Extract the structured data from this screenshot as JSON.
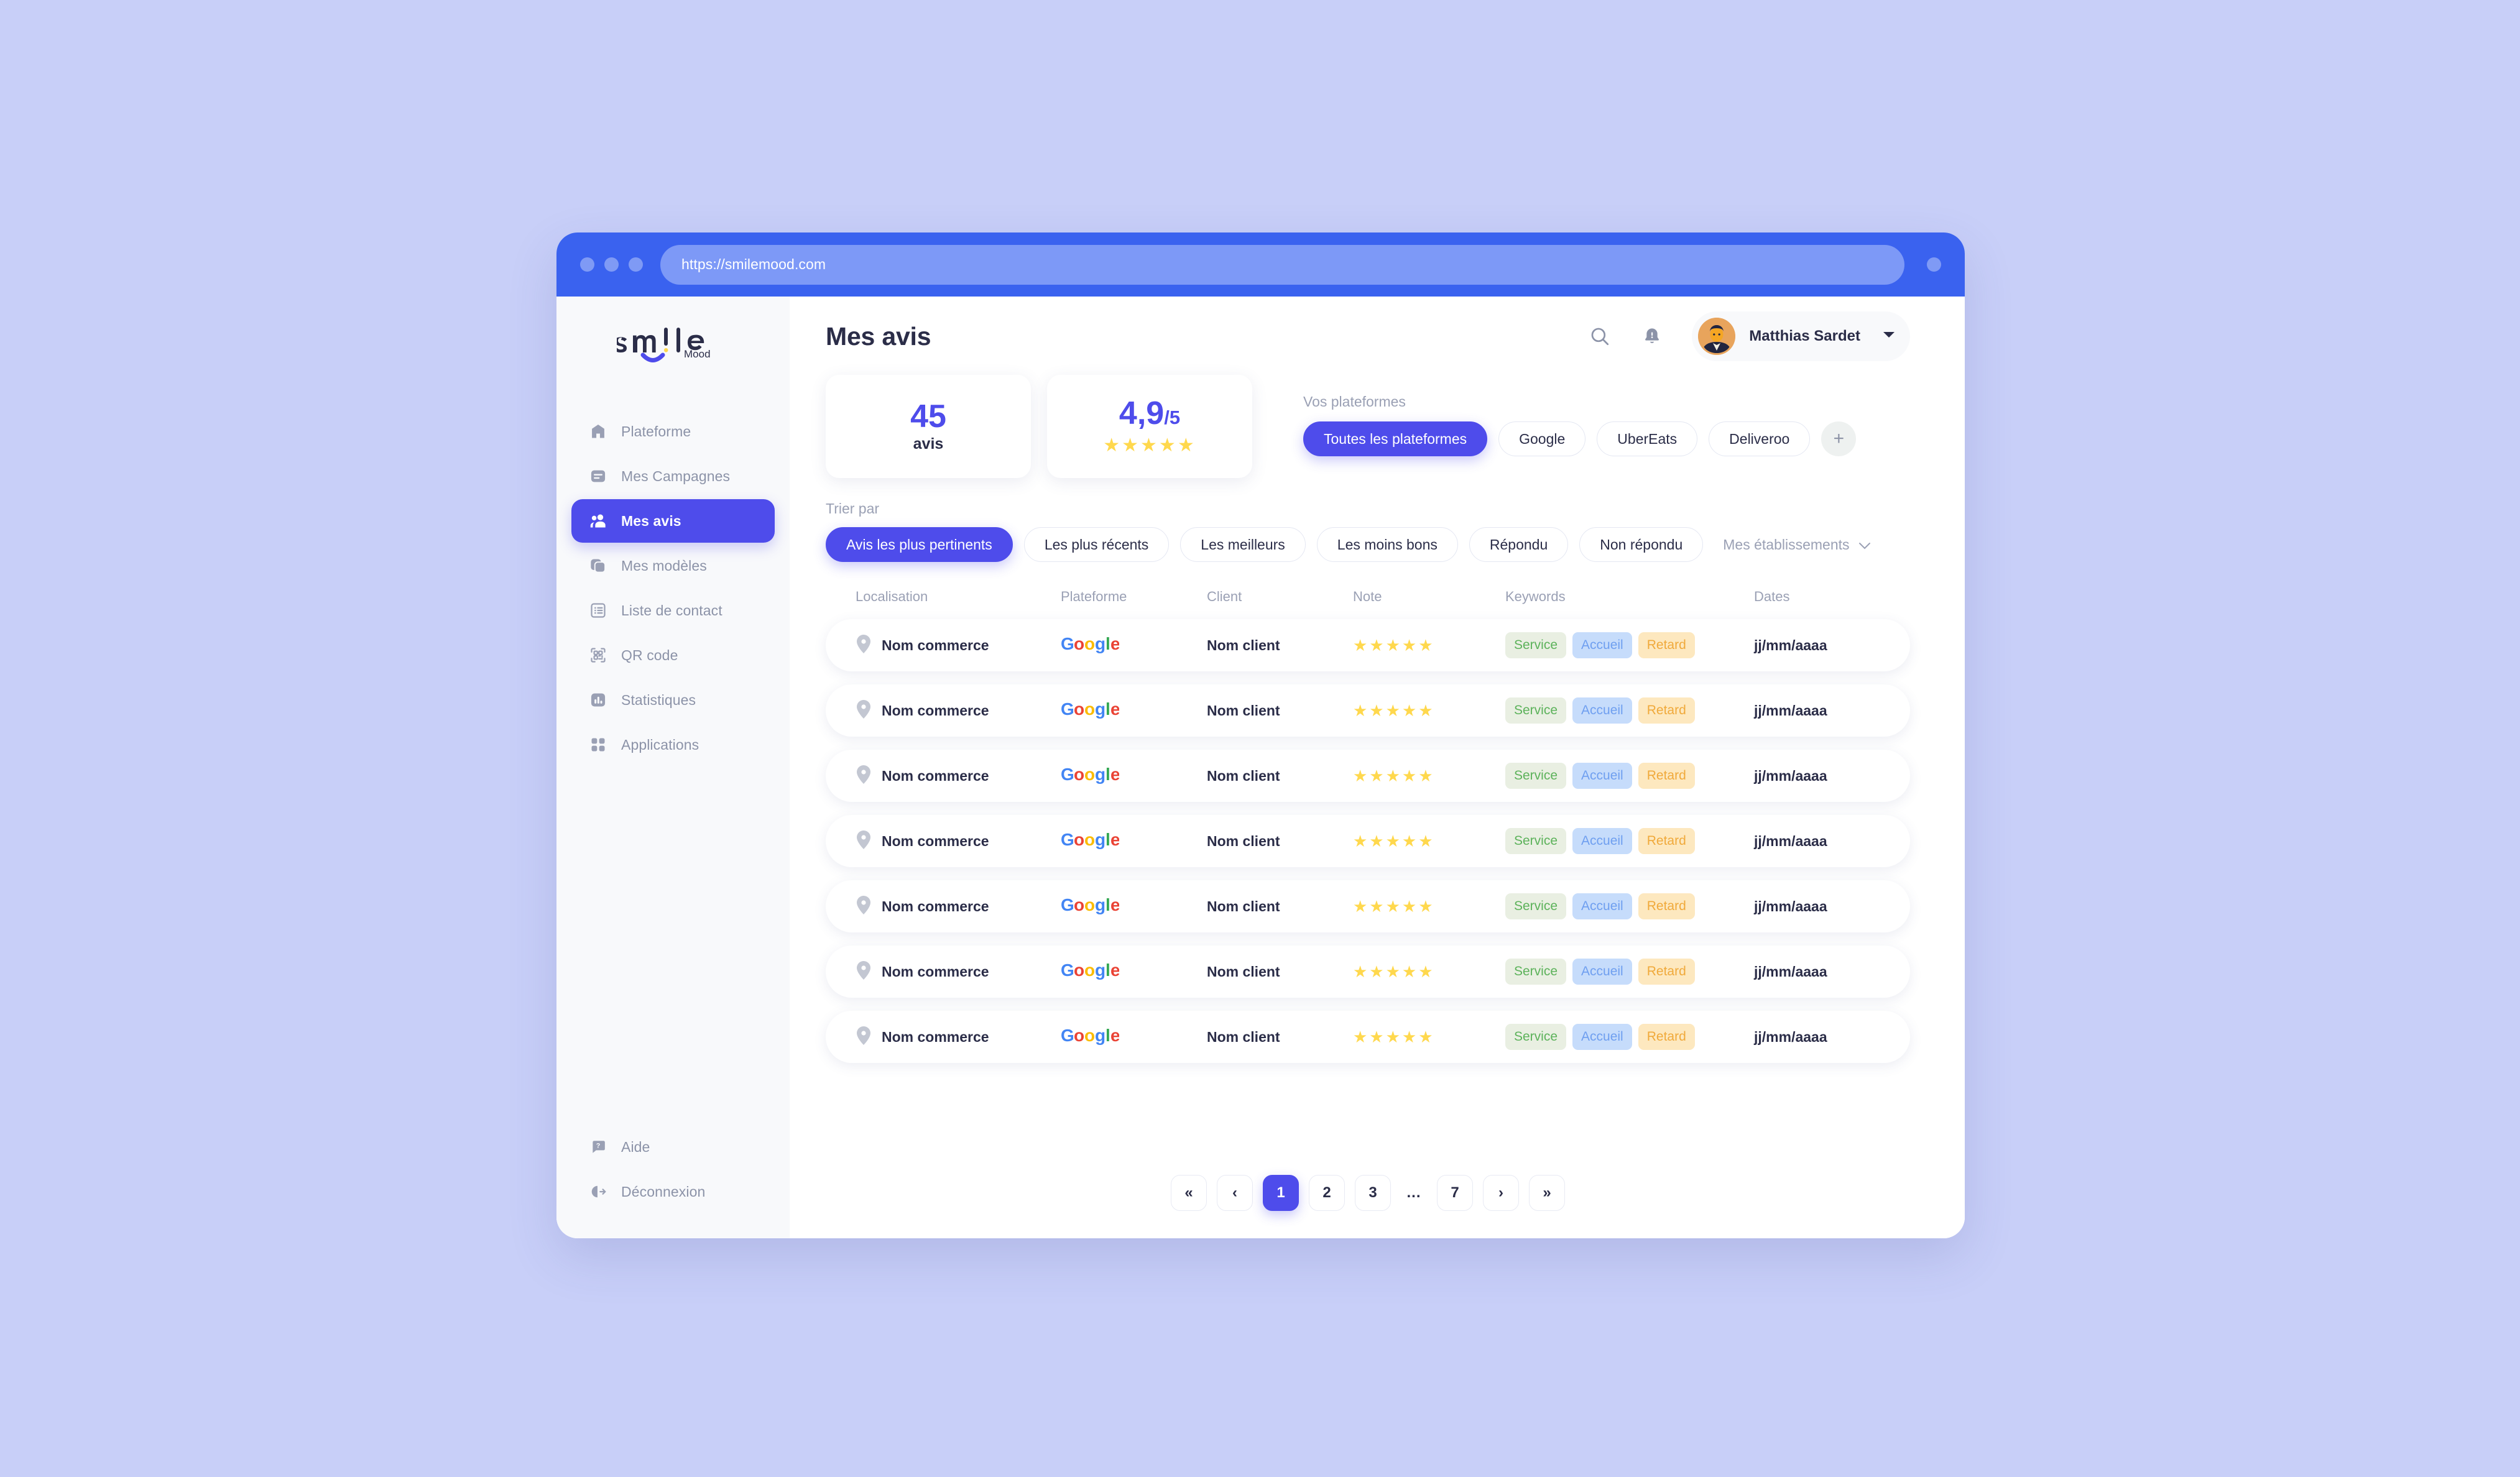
{
  "browser": {
    "url": "https://smilemood.com"
  },
  "brand": {
    "logo_word": "smile",
    "logo_sub": "Mood",
    "accent": "#4e4ceb",
    "chrome_blue": "#3a62ef",
    "star_yellow": "#ffd84d",
    "page_bg": "#c8cff8"
  },
  "sidebar": {
    "items": [
      {
        "label": "Plateforme",
        "icon": "home-icon",
        "active": false
      },
      {
        "label": "Mes Campagnes",
        "icon": "campaign-icon",
        "active": false
      },
      {
        "label": "Mes avis",
        "icon": "people-icon",
        "active": true
      },
      {
        "label": "Mes modèles",
        "icon": "templates-icon",
        "active": false
      },
      {
        "label": "Liste de contact",
        "icon": "list-icon",
        "active": false
      },
      {
        "label": "QR code",
        "icon": "qr-code-icon",
        "active": false
      },
      {
        "label": "Statistiques",
        "icon": "bar-chart-icon",
        "active": false
      },
      {
        "label": "Applications",
        "icon": "grid-apps-icon",
        "active": false
      }
    ],
    "bottom_items": [
      {
        "label": "Aide",
        "icon": "help-bubble-icon"
      },
      {
        "label": "Déconnexion",
        "icon": "logout-icon"
      }
    ]
  },
  "header": {
    "title": "Mes avis",
    "search_icon": "search-icon",
    "bell_icon": "bell-icon",
    "profile_name": "Matthias Sardet",
    "caret_icon": "chevron-down-icon"
  },
  "stats": {
    "reviews_count": "45",
    "reviews_label": "avis",
    "rating_value": "4,9",
    "rating_denom": "/5",
    "rating_stars": "★★★★★"
  },
  "platforms": {
    "label": "Vos plateformes",
    "chips": [
      {
        "label": "Toutes les plateformes",
        "active": true
      },
      {
        "label": "Google",
        "active": false
      },
      {
        "label": "UberEats",
        "active": false
      },
      {
        "label": "Deliveroo",
        "active": false
      }
    ],
    "add_label": "+"
  },
  "sort": {
    "label": "Trier par",
    "chips": [
      {
        "label": "Avis les plus pertinents",
        "active": true
      },
      {
        "label": "Les plus récents",
        "active": false
      },
      {
        "label": "Les meilleurs",
        "active": false
      },
      {
        "label": "Les moins bons",
        "active": false
      },
      {
        "label": "Répondu",
        "active": false
      },
      {
        "label": "Non répondu",
        "active": false
      }
    ],
    "establishments_label": "Mes établissements",
    "establishments_caret": "chevron-down-icon"
  },
  "table": {
    "columns": [
      "Localisation",
      "Plateforme",
      "Client",
      "Note",
      "Keywords",
      "Dates"
    ],
    "rows": [
      {
        "location": "Nom commerce",
        "platform": "Google",
        "client": "Nom client",
        "stars": "★★★★★",
        "keywords": [
          "Service",
          "Accueil",
          "Retard"
        ],
        "date": "jj/mm/aaaa"
      },
      {
        "location": "Nom commerce",
        "platform": "Google",
        "client": "Nom client",
        "stars": "★★★★★",
        "keywords": [
          "Service",
          "Accueil",
          "Retard"
        ],
        "date": "jj/mm/aaaa"
      },
      {
        "location": "Nom commerce",
        "platform": "Google",
        "client": "Nom client",
        "stars": "★★★★★",
        "keywords": [
          "Service",
          "Accueil",
          "Retard"
        ],
        "date": "jj/mm/aaaa"
      },
      {
        "location": "Nom commerce",
        "platform": "Google",
        "client": "Nom client",
        "stars": "★★★★★",
        "keywords": [
          "Service",
          "Accueil",
          "Retard"
        ],
        "date": "jj/mm/aaaa"
      },
      {
        "location": "Nom commerce",
        "platform": "Google",
        "client": "Nom client",
        "stars": "★★★★★",
        "keywords": [
          "Service",
          "Accueil",
          "Retard"
        ],
        "date": "jj/mm/aaaa"
      },
      {
        "location": "Nom commerce",
        "platform": "Google",
        "client": "Nom client",
        "stars": "★★★★★",
        "keywords": [
          "Service",
          "Accueil",
          "Retard"
        ],
        "date": "jj/mm/aaaa"
      },
      {
        "location": "Nom commerce",
        "platform": "Google",
        "client": "Nom client",
        "stars": "★★★★★",
        "keywords": [
          "Service",
          "Accueil",
          "Retard"
        ],
        "date": "jj/mm/aaaa"
      }
    ]
  },
  "pagination": {
    "first_label": "«",
    "prev_label": "‹",
    "pages": [
      "1",
      "2",
      "3"
    ],
    "ellipsis": "...",
    "last_page": "7",
    "next_label": "›",
    "last_label": "»",
    "current": "1"
  }
}
